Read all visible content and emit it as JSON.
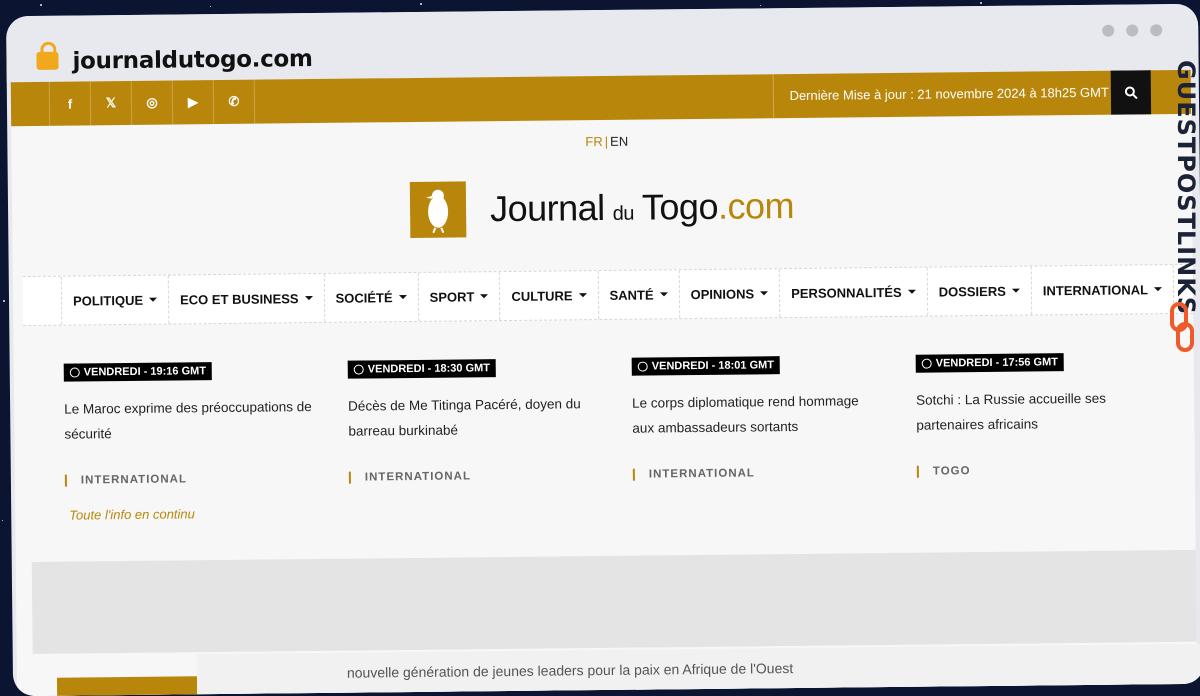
{
  "browser": {
    "url": "journaldutogo.com"
  },
  "topbar": {
    "social": [
      {
        "name": "facebook-icon",
        "glyph": "f"
      },
      {
        "name": "x-icon",
        "glyph": "𝕏"
      },
      {
        "name": "instagram-icon",
        "glyph": "◎"
      },
      {
        "name": "youtube-icon",
        "glyph": "▶"
      },
      {
        "name": "whatsapp-icon",
        "glyph": "✆"
      }
    ],
    "update_text": "Dernière Mise à jour : 21 novembre 2024 à 18h25 GMT"
  },
  "lang": {
    "fr": "FR",
    "sep": "|",
    "en": "EN"
  },
  "logo": {
    "part1": "Journal",
    "part2": "du",
    "part3": "Togo",
    "part4": ".com"
  },
  "nav": [
    "POLITIQUE",
    "ECO ET BUSINESS",
    "SOCIÉTÉ",
    "SPORT",
    "CULTURE",
    "SANTÉ",
    "OPINIONS",
    "PERSONNALITÉS",
    "DOSSIERS",
    "INTERNATIONAL"
  ],
  "news": [
    {
      "time": "VENDREDI - 19:16 GMT",
      "title": "Le Maroc exprime des préoccupations de sécurité",
      "category": "INTERNATIONAL"
    },
    {
      "time": "VENDREDI - 18:30 GMT",
      "title": "Décès de Me Titinga Pacéré, doyen du barreau burkinabé",
      "category": "INTERNATIONAL"
    },
    {
      "time": "VENDREDI - 18:01 GMT",
      "title": "Le corps diplomatique rend hommage aux ambassadeurs sortants",
      "category": "INTERNATIONAL"
    },
    {
      "time": "VENDREDI - 17:56 GMT",
      "title": "Sotchi : La Russie accueille ses partenaires africains",
      "category": "TOGO"
    }
  ],
  "continu": "Toute l'info en continu",
  "ticker": "nouvelle génération de jeunes leaders pour la paix en Afrique de l'Ouest",
  "brand": "GUESTPOSTLINKS",
  "colors": {
    "accent": "#b8860b",
    "background": "#0b1430"
  }
}
